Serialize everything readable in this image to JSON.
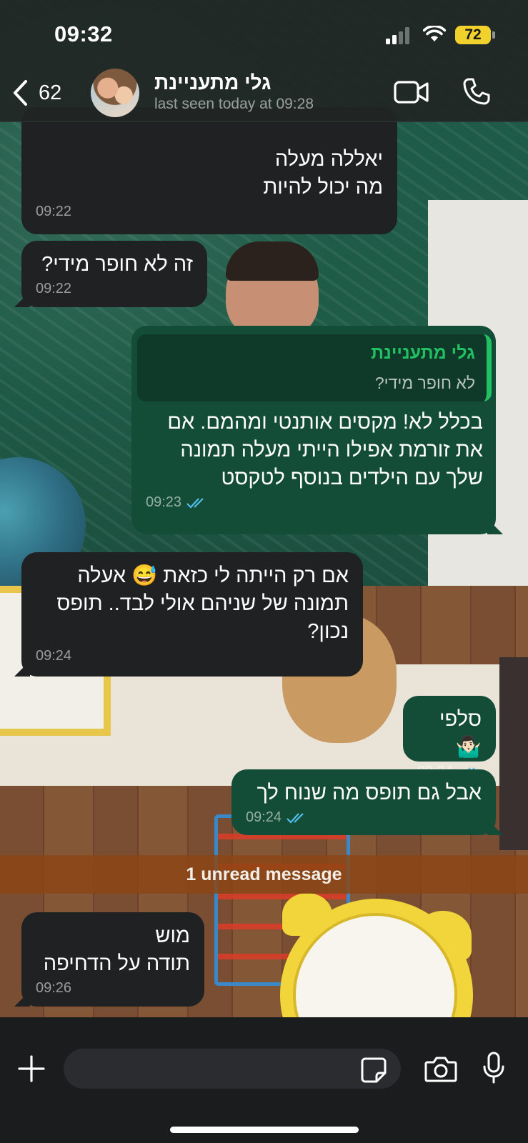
{
  "status_bar": {
    "time": "09:32",
    "battery": "72"
  },
  "header": {
    "back_count": "62",
    "contact_name": "גלי מתעניינת",
    "last_seen": "last seen today at 09:28"
  },
  "messages": [
    {
      "direction": "in",
      "text": "יאללה מעלה\nמה יכול להיות",
      "time": "09:22"
    },
    {
      "direction": "in",
      "text": "זה לא חופר מידי?",
      "time": "09:22"
    },
    {
      "direction": "out",
      "quote_author": "גלי מתעניינת",
      "quote_text": "לא חופר מידי?",
      "text": "בכלל לא! מקסים אותנטי ומהמם. אם את זורמת אפילו הייתי מעלה תמונה שלך עם הילדים בנוסף לטקסט",
      "time": "09:23"
    },
    {
      "direction": "in",
      "text": "אם רק הייתה לי כזאת 😅 אעלה תמונה של שניהם אולי לבד.. תופס נכון?",
      "time": "09:24"
    },
    {
      "direction": "out",
      "text": "סלפי 🤷🏻‍♂️",
      "time": "09:24"
    },
    {
      "direction": "out",
      "text": "אבל גם תופס מה שנוח לך",
      "time": "09:24"
    },
    {
      "direction": "in",
      "text": "מוש\nתודה על הדחיפה",
      "time": "09:26"
    }
  ],
  "unread_label": "1 unread message",
  "colors": {
    "accent": "#21c063",
    "outgoing": "#134d37",
    "incoming": "#1f2123",
    "read_ticks": "#53bdeb",
    "battery": "#f1d12b"
  },
  "icons": [
    "back-chevron-icon",
    "video-call-icon",
    "phone-icon",
    "plus-icon",
    "sticker-icon",
    "camera-icon",
    "microphone-icon",
    "double-check-icon"
  ]
}
